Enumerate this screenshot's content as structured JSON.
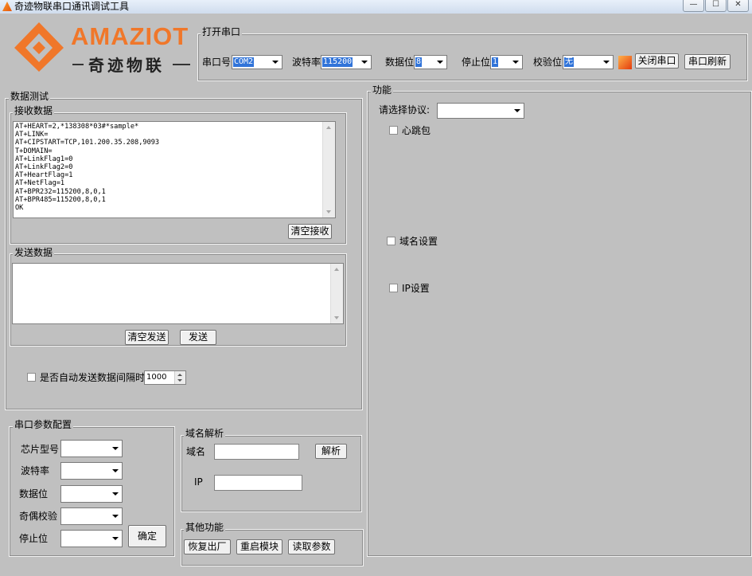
{
  "window": {
    "title": "奇迹物联串口通讯调试工具",
    "min": "—",
    "max": "☐",
    "close": "✕"
  },
  "logo": {
    "word": "AMAZIOT",
    "sub": "奇迹物联"
  },
  "open_port": {
    "legend": "打开串口",
    "port_label": "串口号",
    "port_value": "COM2",
    "baud_label": "波特率",
    "baud_value": "115200",
    "databits_label": "数据位",
    "databits_value": "8",
    "stopbits_label": "停止位",
    "stopbits_value": "1",
    "parity_label": "校验位",
    "parity_value": "无",
    "parity_color": "#f05a14",
    "close_btn": "关闭串口",
    "refresh_btn": "串口刷新"
  },
  "data_test": {
    "legend": "数据测试",
    "recv": {
      "legend": "接收数据",
      "text": "AT+HEART=2,*138308*03#*sample*\nAT+LINK=\nAT+CIPSTART=TCP,101.200.35.208,9093\nT+DOMAIN=\nAT+LinkFlag1=0\nAT+LinkFlag2=0\nAT+HeartFlag=1\nAT+NetFlag=1\nAT+BPR232=115200,8,0,1\nAT+BPR485=115200,8,0,1\nOK",
      "clear_btn": "清空接收"
    },
    "send": {
      "legend": "发送数据",
      "text": "",
      "clear_btn": "清空发送",
      "send_btn": "发送"
    },
    "auto_send": {
      "label": "是否自动发送数据间隔时间",
      "interval": "1000",
      "checked": false
    }
  },
  "serial_config": {
    "legend": "串口参数配置",
    "fields": [
      "芯片型号",
      "波特率",
      "数据位",
      "奇偶校验",
      "停止位"
    ],
    "confirm_btn": "确定"
  },
  "dns": {
    "legend": "域名解析",
    "domain_label": "域名",
    "ip_label": "IP",
    "parse_btn": "解析"
  },
  "other": {
    "legend": "其他功能",
    "buttons": [
      "恢复出厂",
      "重启模块",
      "读取参数"
    ]
  },
  "function": {
    "legend": "功能",
    "protocol_label": "请选择协议:",
    "protocol_value": "",
    "options": [
      {
        "label": "心跳包",
        "checked": false
      },
      {
        "label": "域名设置",
        "checked": false
      },
      {
        "label": "IP设置",
        "checked": false
      }
    ]
  }
}
